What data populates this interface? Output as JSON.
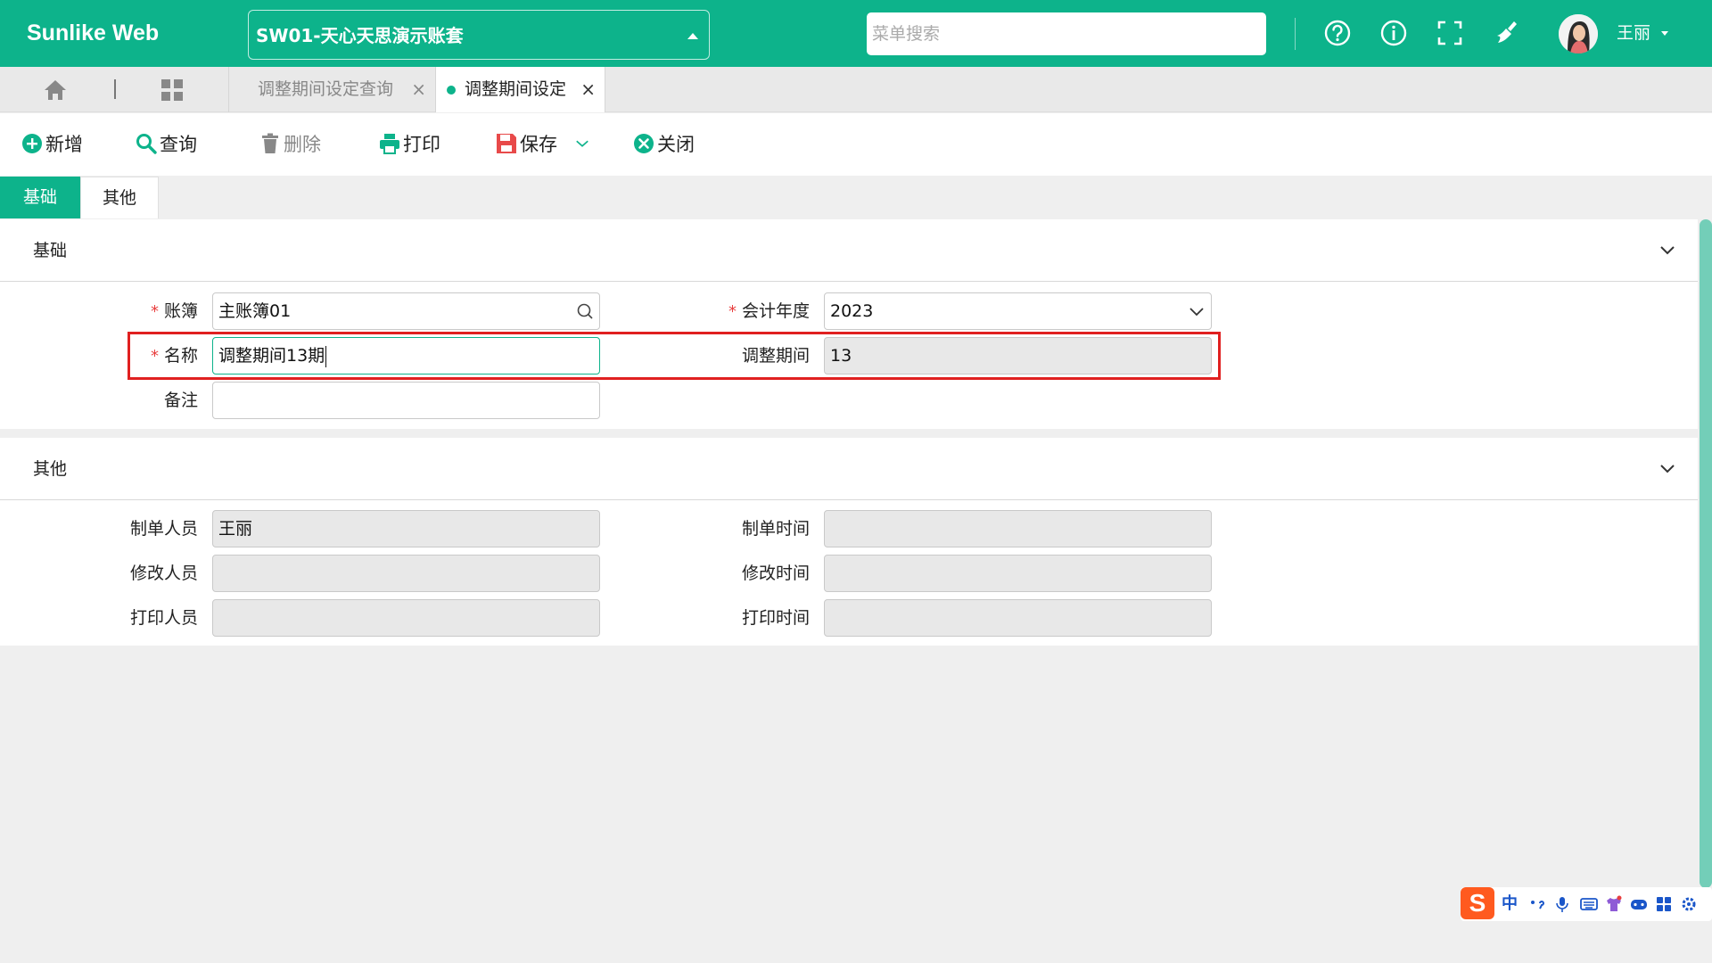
{
  "app": {
    "brand": "Sunlike Web",
    "account": "SW01-天心天思演示账套",
    "menu_search_placeholder": "菜单搜索",
    "user_name": "王丽",
    "top_icons": [
      "help-circle-icon",
      "info-icon",
      "fullscreen-icon",
      "clear-cache-icon"
    ]
  },
  "tabs": [
    {
      "label": "调整期间设定查询",
      "active": false
    },
    {
      "label": "调整期间设定",
      "active": true
    }
  ],
  "toolbar": {
    "add": "新增",
    "query": "查询",
    "delete": "删除",
    "print": "打印",
    "save": "保存",
    "close": "关闭"
  },
  "section_tabs": [
    "基础",
    "其他"
  ],
  "basic": {
    "title": "基础",
    "ledger_label": "账簿",
    "ledger_value": "主账簿01",
    "year_label": "会计年度",
    "year_value": "2023",
    "name_label": "名称",
    "name_value": "调整期间13期",
    "period_label": "调整期间",
    "period_value": "13",
    "remark_label": "备注",
    "remark_value": ""
  },
  "other": {
    "title": "其他",
    "creator_label": "制单人员",
    "creator_value": "王丽",
    "created_time_label": "制单时间",
    "created_time_value": "",
    "modifier_label": "修改人员",
    "modifier_value": "",
    "modified_time_label": "修改时间",
    "modified_time_value": "",
    "printer_label": "打印人员",
    "printer_value": "",
    "print_time_label": "打印时间",
    "print_time_value": ""
  },
  "ime": {
    "mode": "中"
  },
  "colors": {
    "primary": "#0db38b",
    "required": "#e83e3e",
    "highlight": "#e02020"
  }
}
